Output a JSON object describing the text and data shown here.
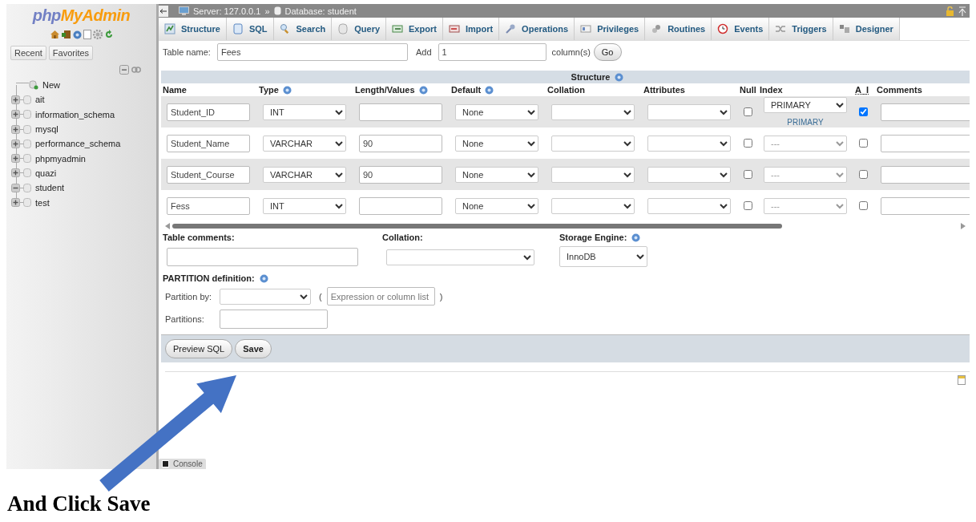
{
  "sidebar": {
    "logo": {
      "prefix": "php",
      "name": "MyAdmin"
    },
    "tabs": [
      {
        "label": "Recent"
      },
      {
        "label": "Favorites"
      }
    ],
    "tree": [
      {
        "kind": "new",
        "label": "New"
      },
      {
        "kind": "database",
        "label": "ait",
        "expanded": false
      },
      {
        "kind": "database",
        "label": "information_schema",
        "expanded": false
      },
      {
        "kind": "database",
        "label": "mysql",
        "expanded": false
      },
      {
        "kind": "database",
        "label": "performance_schema",
        "expanded": false
      },
      {
        "kind": "database",
        "label": "phpmyadmin",
        "expanded": false
      },
      {
        "kind": "database",
        "label": "quazi",
        "expanded": false
      },
      {
        "kind": "database",
        "label": "student",
        "expanded": true
      },
      {
        "kind": "database",
        "label": "test",
        "expanded": false
      }
    ]
  },
  "breadcrumb": {
    "server": "Server: 127.0.0.1",
    "separator": "»",
    "database": "Database: student"
  },
  "tabs": [
    {
      "label": "Structure",
      "selected": false
    },
    {
      "label": "SQL",
      "selected": false
    },
    {
      "label": "Search",
      "selected": false
    },
    {
      "label": "Query",
      "selected": false
    },
    {
      "label": "Export",
      "selected": false
    },
    {
      "label": "Import",
      "selected": false
    },
    {
      "label": "Operations",
      "selected": false
    },
    {
      "label": "Privileges",
      "selected": false
    },
    {
      "label": "Routines",
      "selected": false
    },
    {
      "label": "Events",
      "selected": false
    },
    {
      "label": "Triggers",
      "selected": false
    },
    {
      "label": "Designer",
      "selected": false
    }
  ],
  "table_form": {
    "name_label": "Table name:",
    "name_value": "Fees",
    "add_label": "Add",
    "add_value": "1",
    "columns_label": "column(s)",
    "go_button": "Go"
  },
  "structure": {
    "title": "Structure",
    "headers": [
      {
        "label": "Name"
      },
      {
        "label": "Type",
        "help": true
      },
      {
        "label": "Length/Values",
        "help": true
      },
      {
        "label": "Default",
        "help": true
      },
      {
        "label": "Collation"
      },
      {
        "label": "Attributes"
      },
      {
        "label": "Null"
      },
      {
        "label": "Index"
      },
      {
        "label": "A_I",
        "kind": "abbr"
      },
      {
        "label": "Comments"
      }
    ],
    "rows": [
      {
        "name": "Student_ID",
        "type": "INT",
        "default": "None",
        "null": false,
        "index": "PRIMARY",
        "index_note": "PRIMARY",
        "auto_increment": true
      },
      {
        "name": "Student_Name",
        "type": "VARCHAR",
        "length": "90",
        "default": "None",
        "null": false,
        "index": "---",
        "auto_increment": false
      },
      {
        "name": "Student_Course",
        "type": "VARCHAR",
        "length": "90",
        "default": "None",
        "null": false,
        "index": "---",
        "auto_increment": false
      },
      {
        "name": "Fess",
        "type": "INT",
        "default": "None",
        "null": false,
        "index": "---",
        "auto_increment": false
      }
    ]
  },
  "table_options": {
    "comments_label": "Table comments:",
    "collation_label": "Collation:",
    "engine_label": "Storage Engine:",
    "engine_value": "InnoDB"
  },
  "partition": {
    "title": "PARTITION definition:",
    "by_label": "Partition by:",
    "open_paren": "(",
    "expression_placeholder": "Expression or column list",
    "close_paren": ")",
    "partitions_label": "Partitions:"
  },
  "buttons": [
    {
      "label": "Preview SQL",
      "primary": false
    },
    {
      "label": "Save",
      "primary": true
    }
  ],
  "console": {
    "label": "Console"
  },
  "caption": "And Click Save"
}
